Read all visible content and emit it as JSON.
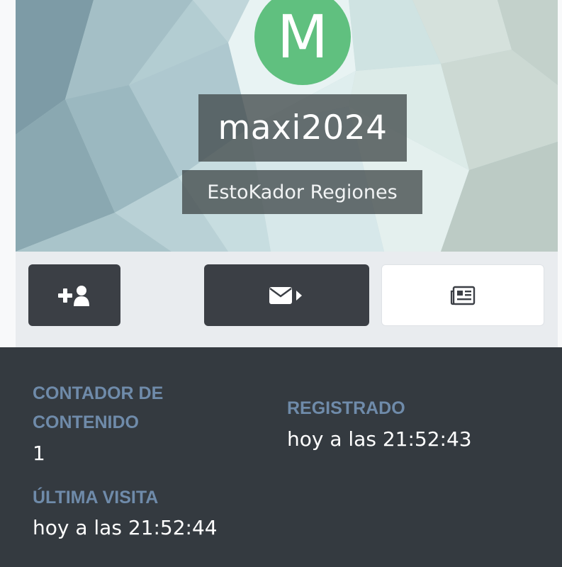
{
  "profile": {
    "avatar_letter": "M",
    "avatar_color": "#60c07f",
    "username": "maxi2024",
    "group": "EstoKador Regiones"
  },
  "actions": [
    {
      "name": "follow",
      "icon": "user-plus-icon"
    },
    {
      "name": "message",
      "icon": "envelope-icon"
    },
    {
      "name": "posts",
      "icon": "newspaper-icon"
    }
  ],
  "stats": {
    "content_count": {
      "label_line1": "CONTADOR DE",
      "label_line2": "CONTENIDO",
      "value": "1"
    },
    "registered": {
      "label": "REGISTRADO",
      "value": "hoy a las 21:52:43"
    },
    "last_visit": {
      "label": "ÚLTIMA VISITA",
      "value": "hoy a las 21:52:44"
    }
  },
  "colors": {
    "stats_background": "#343a40",
    "stat_label": "#6f8baa",
    "button_dark": "#3b3f45"
  }
}
